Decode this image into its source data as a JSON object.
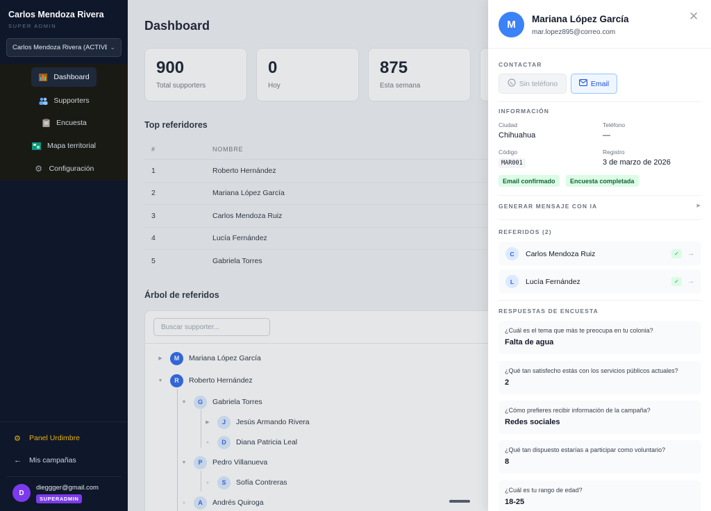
{
  "sidebar": {
    "user_name": "Carlos Mendoza Rivera",
    "user_role": "SUPER ADMIN",
    "campaign_select": "Carlos Mendoza Rivera (ACTIVE",
    "nav": [
      {
        "label": "Dashboard",
        "icon": "chart-icon",
        "active": true
      },
      {
        "label": "Supporters",
        "icon": "people-icon"
      },
      {
        "label": "Encuesta",
        "icon": "clipboard-icon"
      },
      {
        "label": "Mapa territorial",
        "icon": "map-icon"
      },
      {
        "label": "Configuración",
        "icon": "gear-icon"
      }
    ],
    "panel_link": "Panel Urdimbre",
    "campaigns_link": "Mis campañas",
    "account_email": "dieggger@gmail.com",
    "account_initial": "D",
    "account_badge": "SUPERADMIN"
  },
  "main": {
    "title": "Dashboard",
    "stats": [
      {
        "value": "900",
        "label": "Total supporters"
      },
      {
        "value": "0",
        "label": "Hoy"
      },
      {
        "value": "875",
        "label": "Esta semana"
      }
    ],
    "top_referrers": {
      "title": "Top referidores",
      "columns": [
        "#",
        "NOMBRE"
      ],
      "rows": [
        [
          "1",
          "Roberto Hernández"
        ],
        [
          "2",
          "Mariana López García"
        ],
        [
          "3",
          "Carlos Mendoza Ruiz"
        ],
        [
          "4",
          "Lucía Fernández"
        ],
        [
          "5",
          "Gabriela Torres"
        ]
      ]
    },
    "tree": {
      "title": "Árbol de referidos",
      "search_placeholder": "Buscar supporter...",
      "nodes": [
        {
          "initial": "M",
          "name": "Mariana López García",
          "toggle": "▶"
        },
        {
          "initial": "R",
          "name": "Roberto Hernández",
          "toggle": "▼"
        },
        {
          "initial": "G",
          "name": "Gabriela Torres",
          "toggle": "▼"
        },
        {
          "initial": "J",
          "name": "Jesús Armando Rivera",
          "toggle": "▶"
        },
        {
          "initial": "D",
          "name": "Diana Patricia Leal",
          "toggle": "●"
        },
        {
          "initial": "P",
          "name": "Pedro Villanueva",
          "toggle": "▼"
        },
        {
          "initial": "S",
          "name": "Sofía Contreras",
          "toggle": "●"
        },
        {
          "initial": "A",
          "name": "Andrés Quiroga",
          "toggle": "●"
        }
      ]
    }
  },
  "panel": {
    "initial": "M",
    "name": "Mariana López García",
    "email": "mar.lopez895@correo.com",
    "contact_label": "CONTACTAR",
    "no_phone_label": "Sin teléfono",
    "email_button": "Email",
    "info_label": "INFORMACIÓN",
    "fields": {
      "city_label": "Ciudad",
      "city": "Chihuahua",
      "phone_label": "Teléfono",
      "phone": "—",
      "code_label": "Código",
      "code": "MAR001",
      "registered_label": "Registro",
      "registered": "3 de marzo de 2026"
    },
    "tags": [
      "Email confirmado",
      "Encuesta completada"
    ],
    "ai_label": "GENERAR MENSAJE CON IA",
    "referrals_label": "REFERIDOS (2)",
    "referrals": [
      {
        "initial": "C",
        "name": "Carlos Mendoza Ruiz"
      },
      {
        "initial": "L",
        "name": "Lucía Fernández"
      }
    ],
    "survey_label": "RESPUESTAS DE ENCUESTA",
    "survey": [
      {
        "q": "¿Cuál es el tema que más te preocupa en tu colonia?",
        "a": "Falta de agua"
      },
      {
        "q": "¿Qué tan satisfecho estás con los servicios públicos actuales?",
        "a": "2"
      },
      {
        "q": "¿Cómo prefieres recibir información de la campaña?",
        "a": "Redes sociales"
      },
      {
        "q": "¿Qué tan dispuesto estarías a participar como voluntario?",
        "a": "8"
      },
      {
        "q": "¿Cuál es tu rango de edad?",
        "a": "18-25"
      }
    ]
  }
}
